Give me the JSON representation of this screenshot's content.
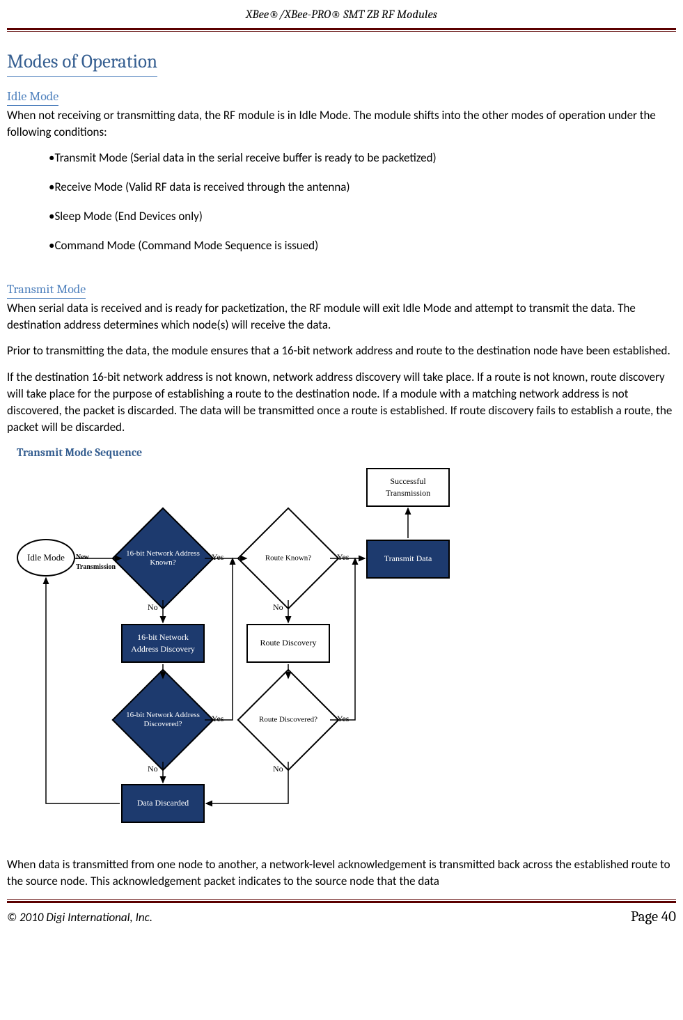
{
  "header": {
    "title": "XBee®/XBee-PRO® SMT ZB RF Modules"
  },
  "section": {
    "title": "Modes of Operation"
  },
  "idle": {
    "heading": "Idle Mode",
    "body": "When not receiving or transmitting data, the RF module is in Idle Mode. The module shifts into the other modes of operation under the following conditions:",
    "bullets": [
      "•Transmit Mode (Serial data in the serial receive buffer is ready to be packetized)",
      "•Receive Mode (Valid RF data is received through the antenna)",
      "•Sleep Mode (End Devices only)",
      "•Command Mode (Command Mode Sequence is issued)"
    ]
  },
  "transmit": {
    "heading": "Transmit Mode",
    "p1": "When serial data is received and is ready for packetization, the RF module will exit Idle Mode and attempt to transmit the data. The destination address determines which node(s) will receive the data.",
    "p2": "Prior to transmitting the data, the module ensures that a 16-bit network address and route to the destination node have been established.",
    "p3": "If the destination 16-bit network address is not known, network address discovery will take place. If a route is not known, route discovery will take place for the purpose of establishing a route to the destination node. If a module with a matching network address is not discovered, the packet is discarded. The data will be transmitted once a route is established. If route discovery fails to establish a route, the packet will be discarded.",
    "p4": "When data is transmitted from one node to another, a network-level acknowledgement is transmitted back across the established route to the source node. This acknowledgement packet indicates to the source node that the data"
  },
  "flowchart": {
    "title": "Transmit Mode Sequence",
    "idle": "Idle Mode",
    "newtrans": "New\nTransmission",
    "addr_known": "16-bit Network Address Known?",
    "route_known": "Route Known?",
    "transmit_data": "Transmit Data",
    "success": "Successful Transmission",
    "addr_discovery": "16-bit Network Address Discovery",
    "route_discovery": "Route Discovery",
    "addr_discovered": "16-bit Network Address Discovered?",
    "route_discovered": "Route Discovered?",
    "discarded": "Data Discarded",
    "yes": "Yes",
    "no": "No"
  },
  "footer": {
    "copyright": "© 2010 Digi International, Inc.",
    "page": "Page 40"
  }
}
